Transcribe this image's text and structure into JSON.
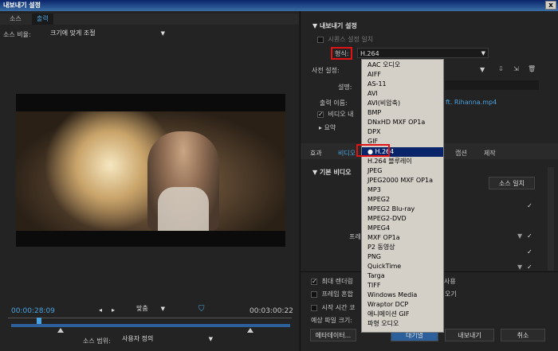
{
  "window": {
    "title": "내보내기 설정",
    "close": "x"
  },
  "left": {
    "tabs": [
      "소스",
      "출력"
    ],
    "scale_label": "소스 비율:",
    "scale_value": "크기에 맞게 조절",
    "current_time": "00:00:28:09",
    "duration": "00:03:00:22",
    "fit_value": "맞춤",
    "range_label": "소스 범위:",
    "range_value": "사용자 정의"
  },
  "right": {
    "export_settings": "내보내기 설정",
    "match_sequence": "시퀀스 설정 일치",
    "format_label": "형식:",
    "format_value": "H.264",
    "preset_label": "사전 설정:",
    "comment_label": "설명:",
    "output_name_label": "출력 이름:",
    "output_name_value": "ft. Rihanna.mp4",
    "export_video": "비디오 내",
    "summary": "요약",
    "tabs": [
      "효과",
      "비디오",
      "캡션",
      "제작"
    ],
    "basic_video": "기본 비디오",
    "match_source": "소스 일치",
    "frame_label": "프레",
    "max_render": "최대 렌더링",
    "use": "사용",
    "frame_blend": "프레임 혼합",
    "frame_blend_right": "오기",
    "start_time": "시작 시간 코",
    "est_size": "예상 파일 크기:",
    "metadata_btn": "메타데이터...",
    "queue_btn": "대기열",
    "export_btn": "내보내기",
    "cancel_btn": "취소"
  },
  "format_dropdown": {
    "items": [
      "AAC 오디오",
      "AIFF",
      "AS-11",
      "AVI",
      "AVI(비압축)",
      "BMP",
      "DNxHD MXF OP1a",
      "DPX",
      "GIF",
      "H.264",
      "H.264 블루레이",
      "JPEG",
      "JPEG2000 MXF OP1a",
      "MP3",
      "MPEG2",
      "MPEG2 Blu-ray",
      "MPEG2-DVD",
      "MPEG4",
      "MXF OP1a",
      "P2 동영상",
      "PNG",
      "QuickTime",
      "Targa",
      "TIFF",
      "Windows Media",
      "Wraptor DCP",
      "애니메이션 GIF",
      "파형 오디오"
    ],
    "selected": "H.264"
  },
  "colors": {
    "accent": "#4aa3df",
    "highlight": "#e01414",
    "selection": "#0a246a"
  }
}
